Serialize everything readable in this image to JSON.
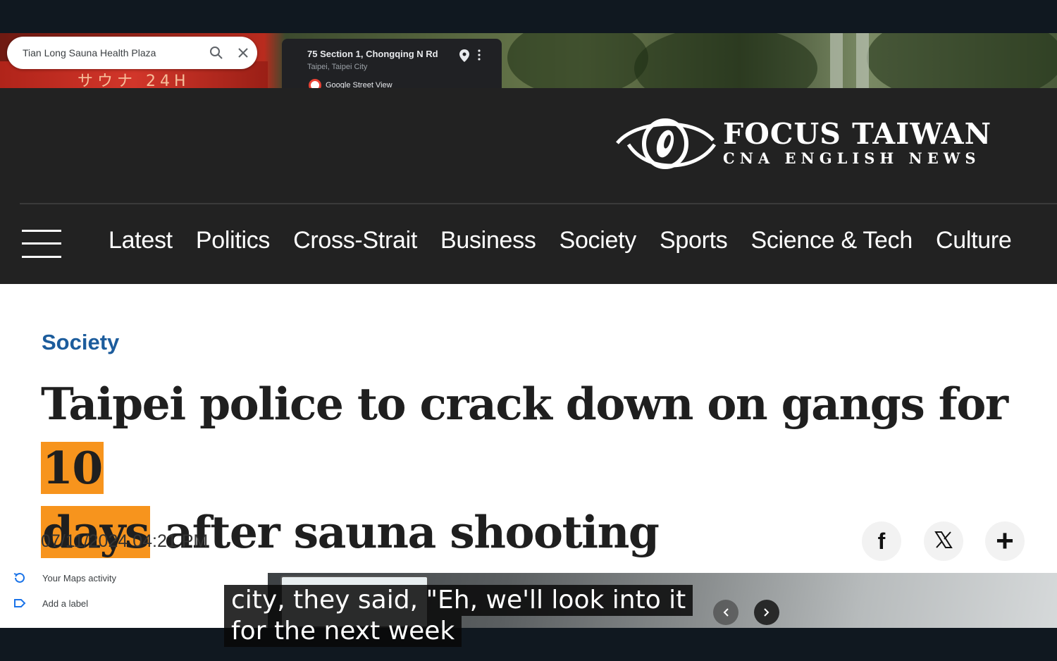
{
  "maps": {
    "search_query": "Tian Long Sauna Health Plaza",
    "sign_text": "サウナ 24H",
    "street_view": {
      "address": "75 Section 1, Chongqing N Rd",
      "locality": "Taipei, Taipei City",
      "source_label": "Google Street View"
    },
    "side_menu": [
      {
        "label": "Your Maps activity",
        "icon": "history-icon"
      },
      {
        "label": "Add a label",
        "icon": "label-icon"
      }
    ]
  },
  "site": {
    "brand_title": "FOCUS TAIWAN",
    "brand_subtitle": "CNA ENGLISH NEWS",
    "nav": [
      "Latest",
      "Politics",
      "Cross-Strait",
      "Business",
      "Society",
      "Sports",
      "Science & Tech",
      "Culture"
    ]
  },
  "article": {
    "category": "Society",
    "headline_part1": "Taipei police to crack down on gangs for ",
    "headline_highlight1": "10",
    "headline_highlight2": "days",
    "headline_part2": " after sauna shooting",
    "date": "07/11/2024 04:21 PM"
  },
  "share": {
    "facebook_glyph": "f",
    "x_glyph": "𝕏",
    "more_glyph": "+"
  },
  "subtitles": {
    "line1": "city, they said, \"Eh, we'll look into it",
    "line2": "for the next week"
  },
  "colors": {
    "header_bg": "#222222",
    "category": "#1c5c9c",
    "highlight": "#f7941d"
  }
}
